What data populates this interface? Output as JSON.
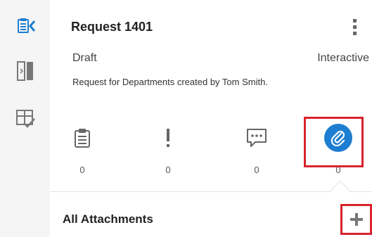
{
  "request": {
    "title": "Request 1401",
    "status": "Draft",
    "mode": "Interactive",
    "description": "Request for Departments created by Tom Smith."
  },
  "tabs": [
    {
      "name": "details",
      "icon": "clipboard-icon",
      "count": "0"
    },
    {
      "name": "issues",
      "icon": "exclamation-icon",
      "count": "0"
    },
    {
      "name": "comments",
      "icon": "chat-bubble-icon",
      "count": "0"
    },
    {
      "name": "attachments",
      "icon": "paperclip-icon",
      "count": "0",
      "active": true
    }
  ],
  "attachments": {
    "section_title": "All Attachments",
    "add_icon": "plus-icon"
  },
  "rail": {
    "items": [
      "collapse-panel-icon",
      "split-panel-icon",
      "review-checklist-icon"
    ]
  },
  "colors": {
    "accent": "#1e7ed1",
    "highlight": "#d9232d",
    "rail_bg": "#f5f5f5"
  }
}
